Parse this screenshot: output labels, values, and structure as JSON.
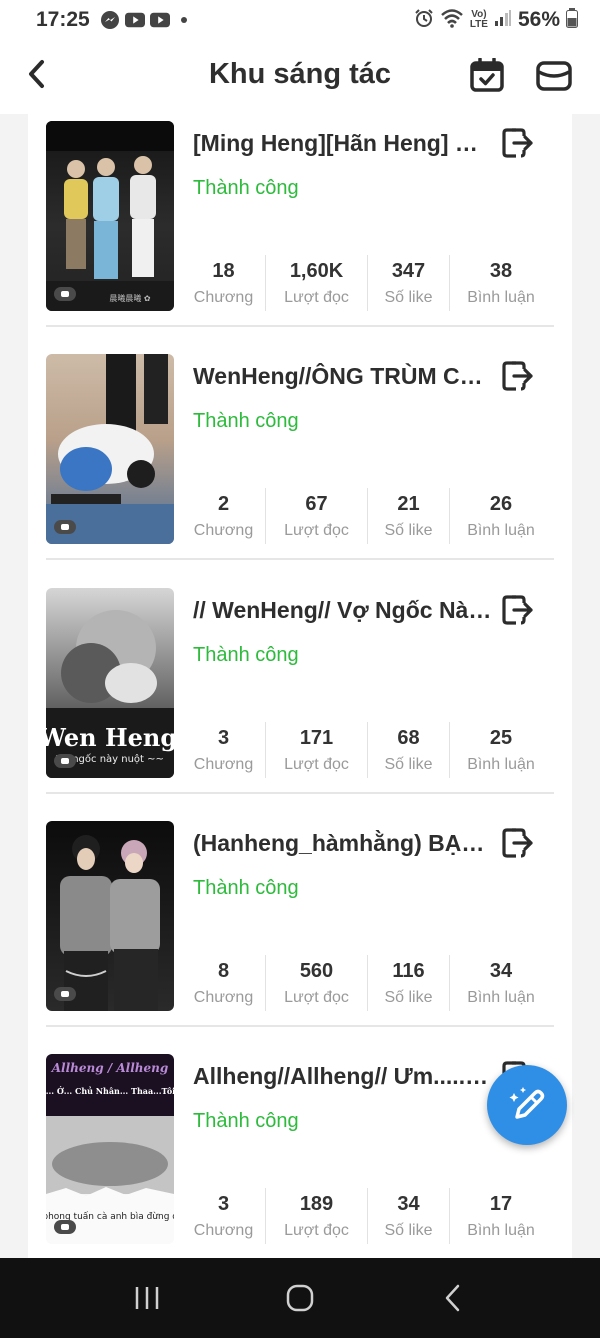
{
  "status_bar": {
    "time": "17:25",
    "battery_text": "56%",
    "apps": [
      "messenger-icon",
      "youtube-icon",
      "youtube-icon"
    ],
    "network": "Vo) LTE"
  },
  "header": {
    "title": "Khu sáng tác"
  },
  "stat_labels": {
    "chapters": "Chương",
    "reads": "Lượt đọc",
    "likes": "Số like",
    "comments": "Bình luận"
  },
  "stories": [
    {
      "title": "[Ming Heng][Hãn Heng] Ức...",
      "status": "Thành công",
      "chapters": "18",
      "reads": "1,60K",
      "likes": "347",
      "comments": "38",
      "cover_text": "",
      "cover_colors": [
        "#1d1d1d",
        "#3a3a3a"
      ]
    },
    {
      "title": "WenHeng//ÔNG TRÙM CŨ...",
      "status": "Thành công",
      "chapters": "2",
      "reads": "67",
      "likes": "21",
      "comments": "26",
      "cover_text": "",
      "cover_colors": [
        "#c9b8a6",
        "#3f5f86"
      ]
    },
    {
      "title": "// WenHeng// Vợ Ngốc Này ...",
      "status": "Thành công",
      "chapters": "3",
      "reads": "171",
      "likes": "68",
      "comments": "25",
      "cover_text": "Wen Heng",
      "cover_subtext": "Vợ ngốc này nuột ~~",
      "cover_colors": [
        "#d8d8d8",
        "#1a1a1a"
      ]
    },
    {
      "title": "(Hanheng_hàmhằng) BẠN ...",
      "status": "Thành công",
      "chapters": "8",
      "reads": "560",
      "likes": "116",
      "comments": "34",
      "cover_text": "",
      "cover_colors": [
        "#0e0e0e",
        "#5a5a5a"
      ]
    },
    {
      "title": "Allheng//Allheng// Ưm..... Ớ...",
      "status": "Thành công",
      "chapters": "3",
      "reads": "189",
      "likes": "34",
      "comments": "17",
      "cover_text": "Allheng / Allheng",
      "cover_subtext": "Ưm..... Ớ... Chủ Nhân... Thaa...Tôi~~~",
      "cover_caption": "con vk phong tuấn cà anh bìa đừng qtam nh",
      "cover_colors": [
        "#1b0f22",
        "#dcdcdc"
      ]
    }
  ],
  "colors": {
    "accent_green": "#2dbb3c",
    "fab_blue": "#2f8fe6"
  }
}
